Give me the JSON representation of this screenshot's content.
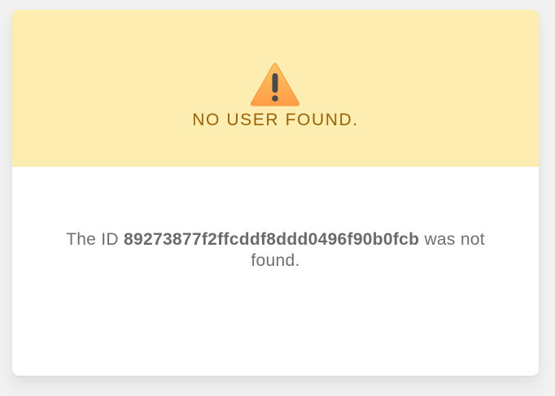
{
  "banner": {
    "icon": "warning-icon",
    "title": "NO USER FOUND.",
    "background": "#feedb0",
    "title_color": "#9a6209"
  },
  "message": {
    "prefix": "The ID",
    "user_id": "89273877f2ffcddf8ddd0496f90b0fcb",
    "suffix": "was not found."
  }
}
